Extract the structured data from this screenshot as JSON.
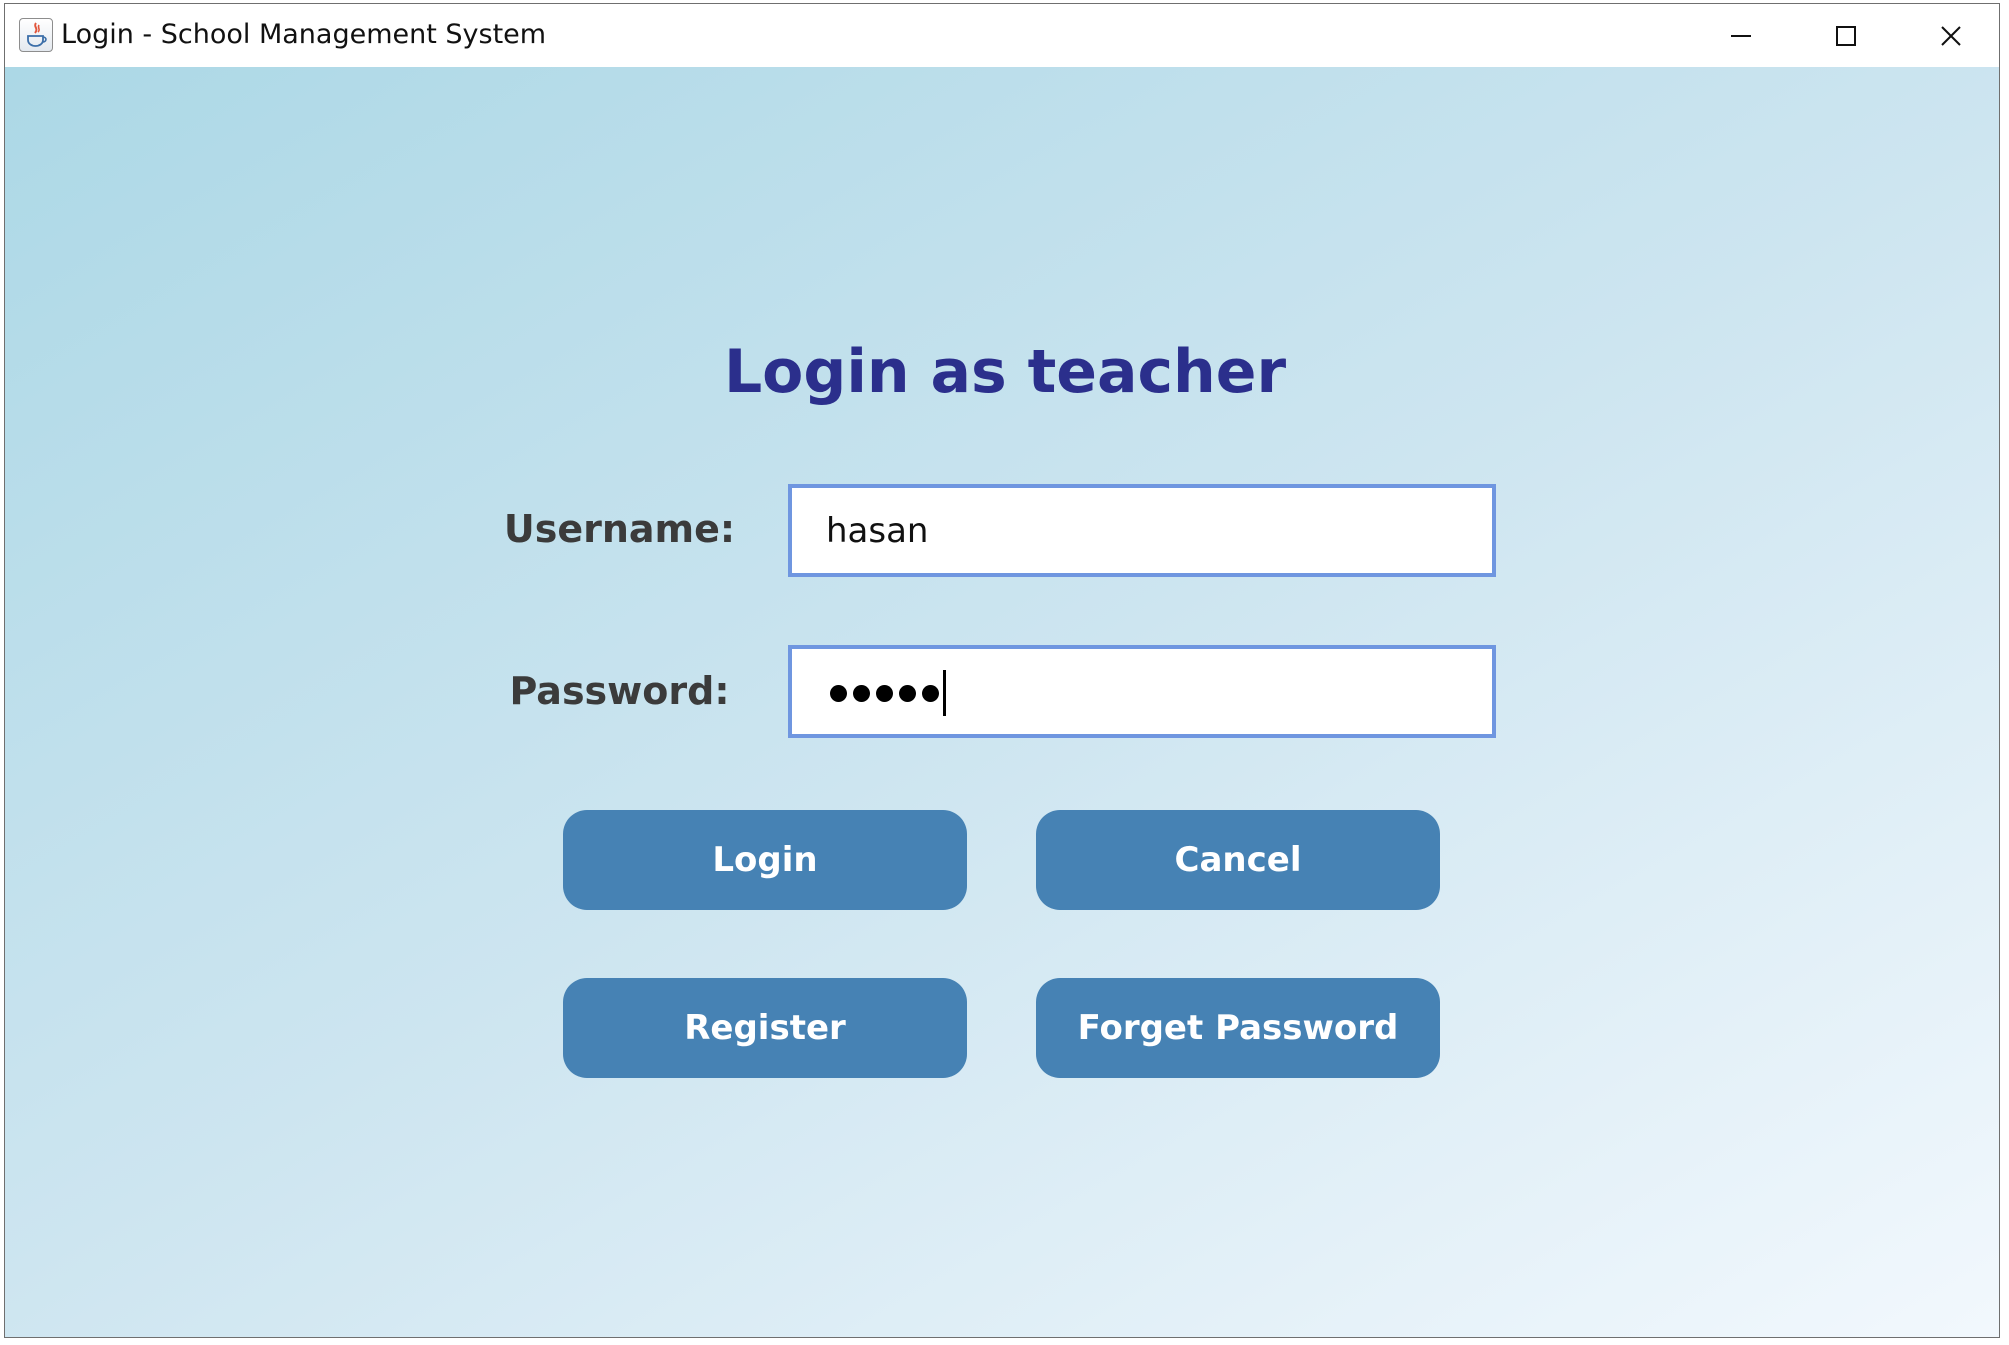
{
  "window": {
    "title": "Login - School Management System",
    "icon": "java-coffee-icon",
    "controls": [
      "minimize-icon",
      "maximize-icon",
      "close-icon"
    ]
  },
  "form": {
    "heading": "Login as teacher",
    "username_label": "Username:",
    "username_value": "hasan",
    "password_label": "Password:",
    "password_masked_length": 5
  },
  "buttons": {
    "login": "Login",
    "cancel": "Cancel",
    "register": "Register",
    "forget_password": "Forget Password"
  },
  "colors": {
    "heading": "#2b2f8c",
    "button_bg": "#4682b4",
    "button_text": "#ffffff",
    "field_border": "#6f96e0",
    "label_text": "#3b3b3b",
    "background_start": "#acd8e6",
    "background_end": "#f2f8fd"
  }
}
